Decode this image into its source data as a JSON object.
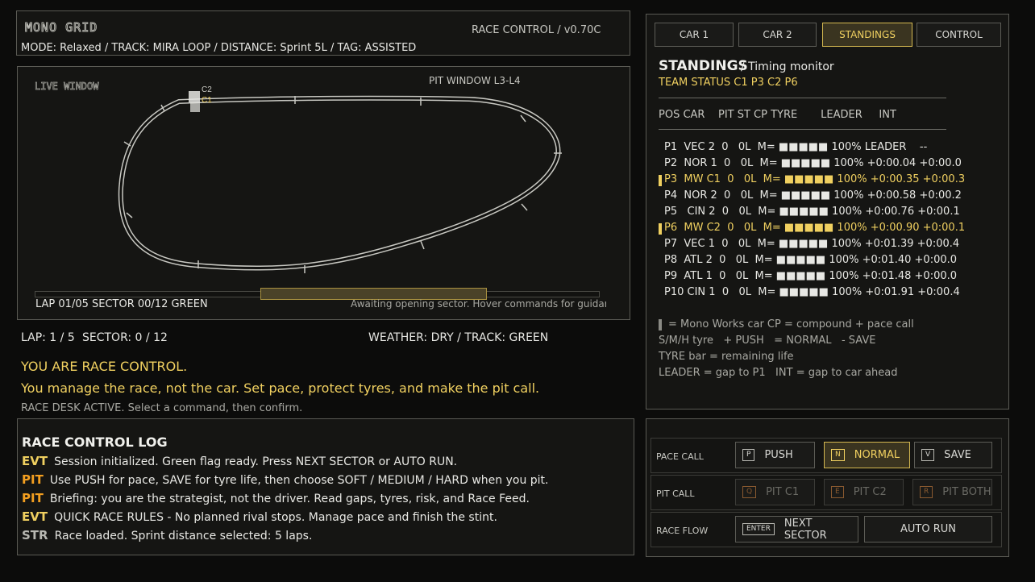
{
  "header": {
    "logo_text": "MONO GRID",
    "race_control_label": "RACE CONTROL  /  v0.70C",
    "mode_line": "MODE: Relaxed  /  TRACK: MIRA LOOP  /  DISTANCE: Sprint 5L  /  TAG: ASSISTED"
  },
  "map": {
    "live_window": "LIVE WINDOW",
    "pit_window": "PIT WINDOW L3-L4",
    "car_labels": [
      "C2",
      "C1"
    ],
    "status_left": "LAP 01/05  SECTOR 00/12  GREEN",
    "status_right": "Awaiting opening sector. Hover commands for guidanc",
    "pit_window_bar": {
      "start_fraction": 0.4,
      "end_fraction": 0.8
    }
  },
  "status": {
    "lap": "LAP: 1 / 5",
    "sector": "SECTOR: 0 / 12",
    "weather": "WEATHER: DRY  /  TRACK: GREEN"
  },
  "intro": {
    "headline": "YOU ARE RACE CONTROL.",
    "subline": "You manage the race, not the car. Set pace, protect tyres, and make the pit call.",
    "desk": "RACE DESK ACTIVE. Select a command, then confirm."
  },
  "log": {
    "title": "RACE CONTROL LOG",
    "entries": [
      {
        "tag": "EVT",
        "text": "Session initialized. Green flag ready. Press NEXT SECTOR or AUTO RUN.",
        "color": "#f0d060"
      },
      {
        "tag": "PIT",
        "text": "Use PUSH for pace, SAVE for tyre life, then choose SOFT / MEDIUM / HARD when you pit.",
        "color": "#f5a020"
      },
      {
        "tag": "PIT",
        "text": "Briefing: you are the strategist, not the driver. Read gaps, tyres, risk, and Race Feed.",
        "color": "#f5a020"
      },
      {
        "tag": "EVT",
        "text": "QUICK RACE RULES - No planned rival stops. Manage pace and finish the stint.",
        "color": "#f0d060"
      },
      {
        "tag": "STR",
        "text": "Race loaded. Sprint distance selected: 5 laps.",
        "color": "#b8b8b2"
      }
    ]
  },
  "tabs": [
    {
      "label": "CAR 1",
      "active": false
    },
    {
      "label": "CAR 2",
      "active": false
    },
    {
      "label": "STANDINGS",
      "active": true
    },
    {
      "label": "CONTROL",
      "active": false
    }
  ],
  "standings": {
    "title": "STANDINGS",
    "subtitle": "/  Timing monitor",
    "team_status": "TEAM STATUS  C1 P3    C2 P6",
    "columns": "POS CAR    PIT ST CP TYRE       LEADER     INT",
    "rows": [
      {
        "text": "P1  VEC 2  0   0L  M= ■■■■■ 100% LEADER    --",
        "hl": false
      },
      {
        "text": "P2  NOR 1  0   0L  M= ■■■■■ 100% +0:00.04 +0:00.0",
        "hl": false
      },
      {
        "text": "P3  MW C1  0   0L  M= ■■■■■ 100% +0:00.35 +0:00.3",
        "hl": true
      },
      {
        "text": "P4  NOR 2  0   0L  M= ■■■■■ 100% +0:00.58 +0:00.2",
        "hl": false
      },
      {
        "text": "P5   CIN 2  0   0L  M= ■■■■■ 100% +0:00.76 +0:00.1",
        "hl": false
      },
      {
        "text": "P6  MW C2  0   0L  M= ■■■■■ 100% +0:00.90 +0:00.1",
        "hl": true
      },
      {
        "text": "P7  VEC 1  0   0L  M= ■■■■■ 100% +0:01.39 +0:00.4",
        "hl": false
      },
      {
        "text": "P8  ATL 2  0   0L  M= ■■■■■ 100% +0:01.40 +0:00.0",
        "hl": false
      },
      {
        "text": "P9  ATL 1  0   0L  M= ■■■■■ 100% +0:01.48 +0:00.0",
        "hl": false
      },
      {
        "text": "P10 CIN 1  0   0L  M= ■■■■■ 100% +0:01.91 +0:00.4",
        "hl": false
      }
    ],
    "legend": [
      "= Mono Works car   CP = compound + pace call",
      "S/M/H tyre   + PUSH   = NORMAL   - SAVE",
      "TYRE bar = remaining life",
      "LEADER = gap to P1   INT = gap to car ahead"
    ]
  },
  "controls": {
    "pace_call": {
      "label": "PACE CALL",
      "buttons": [
        {
          "key": "P",
          "label": "PUSH",
          "state": "normal"
        },
        {
          "key": "N",
          "label": "NORMAL",
          "state": "active"
        },
        {
          "key": "V",
          "label": "SAVE",
          "state": "normal"
        }
      ]
    },
    "pit_call": {
      "label": "PIT CALL",
      "buttons": [
        {
          "key": "Q",
          "label": "PIT C1",
          "state": "disabled"
        },
        {
          "key": "E",
          "label": "PIT C2",
          "state": "disabled"
        },
        {
          "key": "R",
          "label": "PIT BOTH",
          "state": "disabled"
        }
      ]
    },
    "race_flow": {
      "label": "RACE FLOW",
      "next_key": "ENTER",
      "next_label": "NEXT SECTOR",
      "auto_label": "AUTO RUN"
    }
  }
}
